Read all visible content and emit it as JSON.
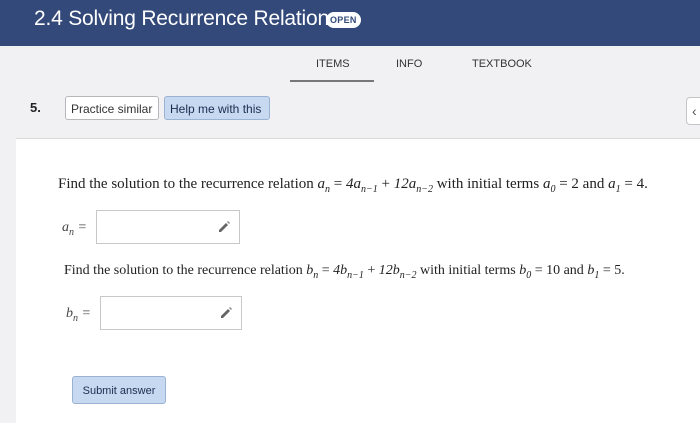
{
  "header": {
    "title": "2.4 Solving Recurrence Relations",
    "badge": "OPEN"
  },
  "tabs": [
    {
      "label": "ITEMS",
      "active": true
    },
    {
      "label": "INFO"
    },
    {
      "label": "TEXTBOOK"
    }
  ],
  "question": {
    "number": "5.",
    "practice_label": "Practice similar",
    "help_label": "Help me with this",
    "part1": {
      "prefix": "Find the solution to the recurrence relation",
      "relation_lhs": "a",
      "relation_rhs1": "4a",
      "relation_rhs2": "12a",
      "middle": "with initial terms",
      "init0": "a",
      "init0_value": "2",
      "and": "and",
      "init1": "a",
      "init1_value": "4.",
      "answer_label": "a",
      "answer_value": ""
    },
    "part2": {
      "prefix": "Find the solution to the recurrence relation",
      "relation_lhs": "b",
      "relation_rhs1": "4b",
      "relation_rhs2": "12b",
      "middle": "with initial terms",
      "init0": "b",
      "init0_value": "10",
      "and": "and",
      "init1": "b",
      "init1_value": "5.",
      "answer_label": "b",
      "answer_value": ""
    },
    "submit_label": "Submit answer"
  },
  "icons": {
    "pencil": "pencil-icon",
    "collapse": "chevron-left-icon"
  },
  "colors": {
    "header": "#33497a",
    "button_blue": "#c6d9f1"
  }
}
